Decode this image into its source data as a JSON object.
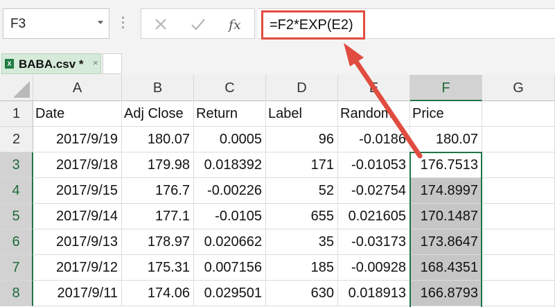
{
  "formula_bar": {
    "name_box": "F3",
    "formula": "=F2*EXP(E2)"
  },
  "tab": {
    "label": "BABA.csv *",
    "close": "×",
    "file_icon": "X"
  },
  "columns": [
    "A",
    "B",
    "C",
    "D",
    "E",
    "F",
    "G"
  ],
  "rows": [
    {
      "num": "1",
      "cells": [
        "Date",
        "Adj Close",
        "Return",
        "Label",
        "Random",
        "Price",
        ""
      ]
    },
    {
      "num": "2",
      "cells": [
        "2017/9/19",
        "180.07",
        "0.0005",
        "96",
        "-0.0186",
        "180.07",
        ""
      ]
    },
    {
      "num": "3",
      "cells": [
        "2017/9/18",
        "179.98",
        "0.018392",
        "171",
        "-0.01053",
        "176.7513",
        ""
      ]
    },
    {
      "num": "4",
      "cells": [
        "2017/9/15",
        "176.7",
        "-0.00226",
        "52",
        "-0.02754",
        "174.8997",
        ""
      ]
    },
    {
      "num": "5",
      "cells": [
        "2017/9/14",
        "177.1",
        "-0.0105",
        "655",
        "0.021605",
        "170.1487",
        ""
      ]
    },
    {
      "num": "6",
      "cells": [
        "2017/9/13",
        "178.97",
        "0.020662",
        "35",
        "-0.03173",
        "173.8647",
        ""
      ]
    },
    {
      "num": "7",
      "cells": [
        "2017/9/12",
        "175.31",
        "0.007156",
        "185",
        "-0.00928",
        "168.4351",
        ""
      ]
    },
    {
      "num": "8",
      "cells": [
        "2017/9/11",
        "174.06",
        "0.029501",
        "630",
        "0.018913",
        "166.8793",
        ""
      ]
    }
  ],
  "selection": {
    "column": "F",
    "rows": [
      "3",
      "4",
      "5",
      "6",
      "7",
      "8"
    ]
  },
  "icons": {
    "name_box_dropdown": "chevron-down-icon",
    "cancel": "close-icon",
    "enter": "check-icon",
    "insert_function": "fx-icon",
    "annotation": "arrow-icon"
  },
  "colors": {
    "accent": "#217346",
    "highlight_box": "#e04c3f",
    "shade": "#c6c6c6",
    "tab": "#d5ead9"
  }
}
